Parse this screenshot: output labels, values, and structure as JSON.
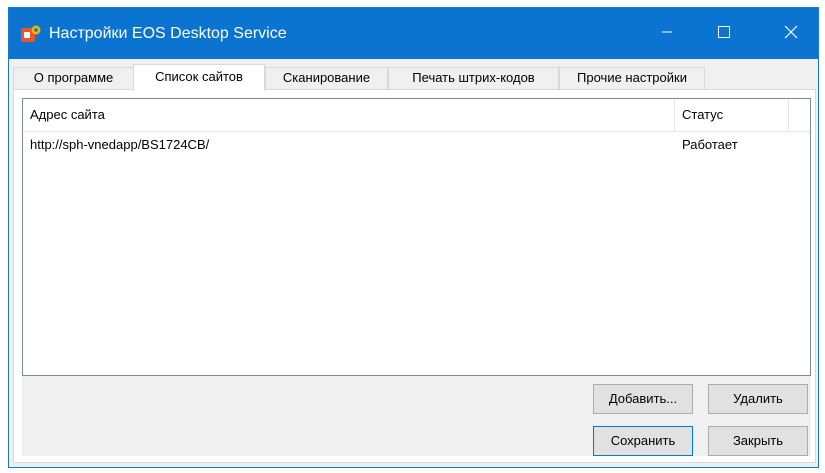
{
  "window": {
    "title": "Настройки EOS Desktop Service",
    "icon": "eos-gear-app-icon",
    "controls": {
      "minimize": "minimize-icon",
      "maximize": "maximize-icon",
      "close": "close-icon"
    }
  },
  "tabs": [
    {
      "label": "О программе",
      "active": false
    },
    {
      "label": "Список сайтов",
      "active": true
    },
    {
      "label": "Сканирование",
      "active": false
    },
    {
      "label": "Печать штрих-кодов",
      "active": false
    },
    {
      "label": "Прочие настройки",
      "active": false
    }
  ],
  "sites": {
    "columns": {
      "address": "Адрес сайта",
      "status": "Статус"
    },
    "rows": [
      {
        "address": "http://sph-vnedapp/BS1724CB/",
        "status": "Работает"
      }
    ]
  },
  "buttons": {
    "add": "Добавить...",
    "remove": "Удалить",
    "save": "Сохранить",
    "close": "Закрыть"
  },
  "colors": {
    "titlebar": "#0b74d1",
    "accent": "#0078d7"
  }
}
